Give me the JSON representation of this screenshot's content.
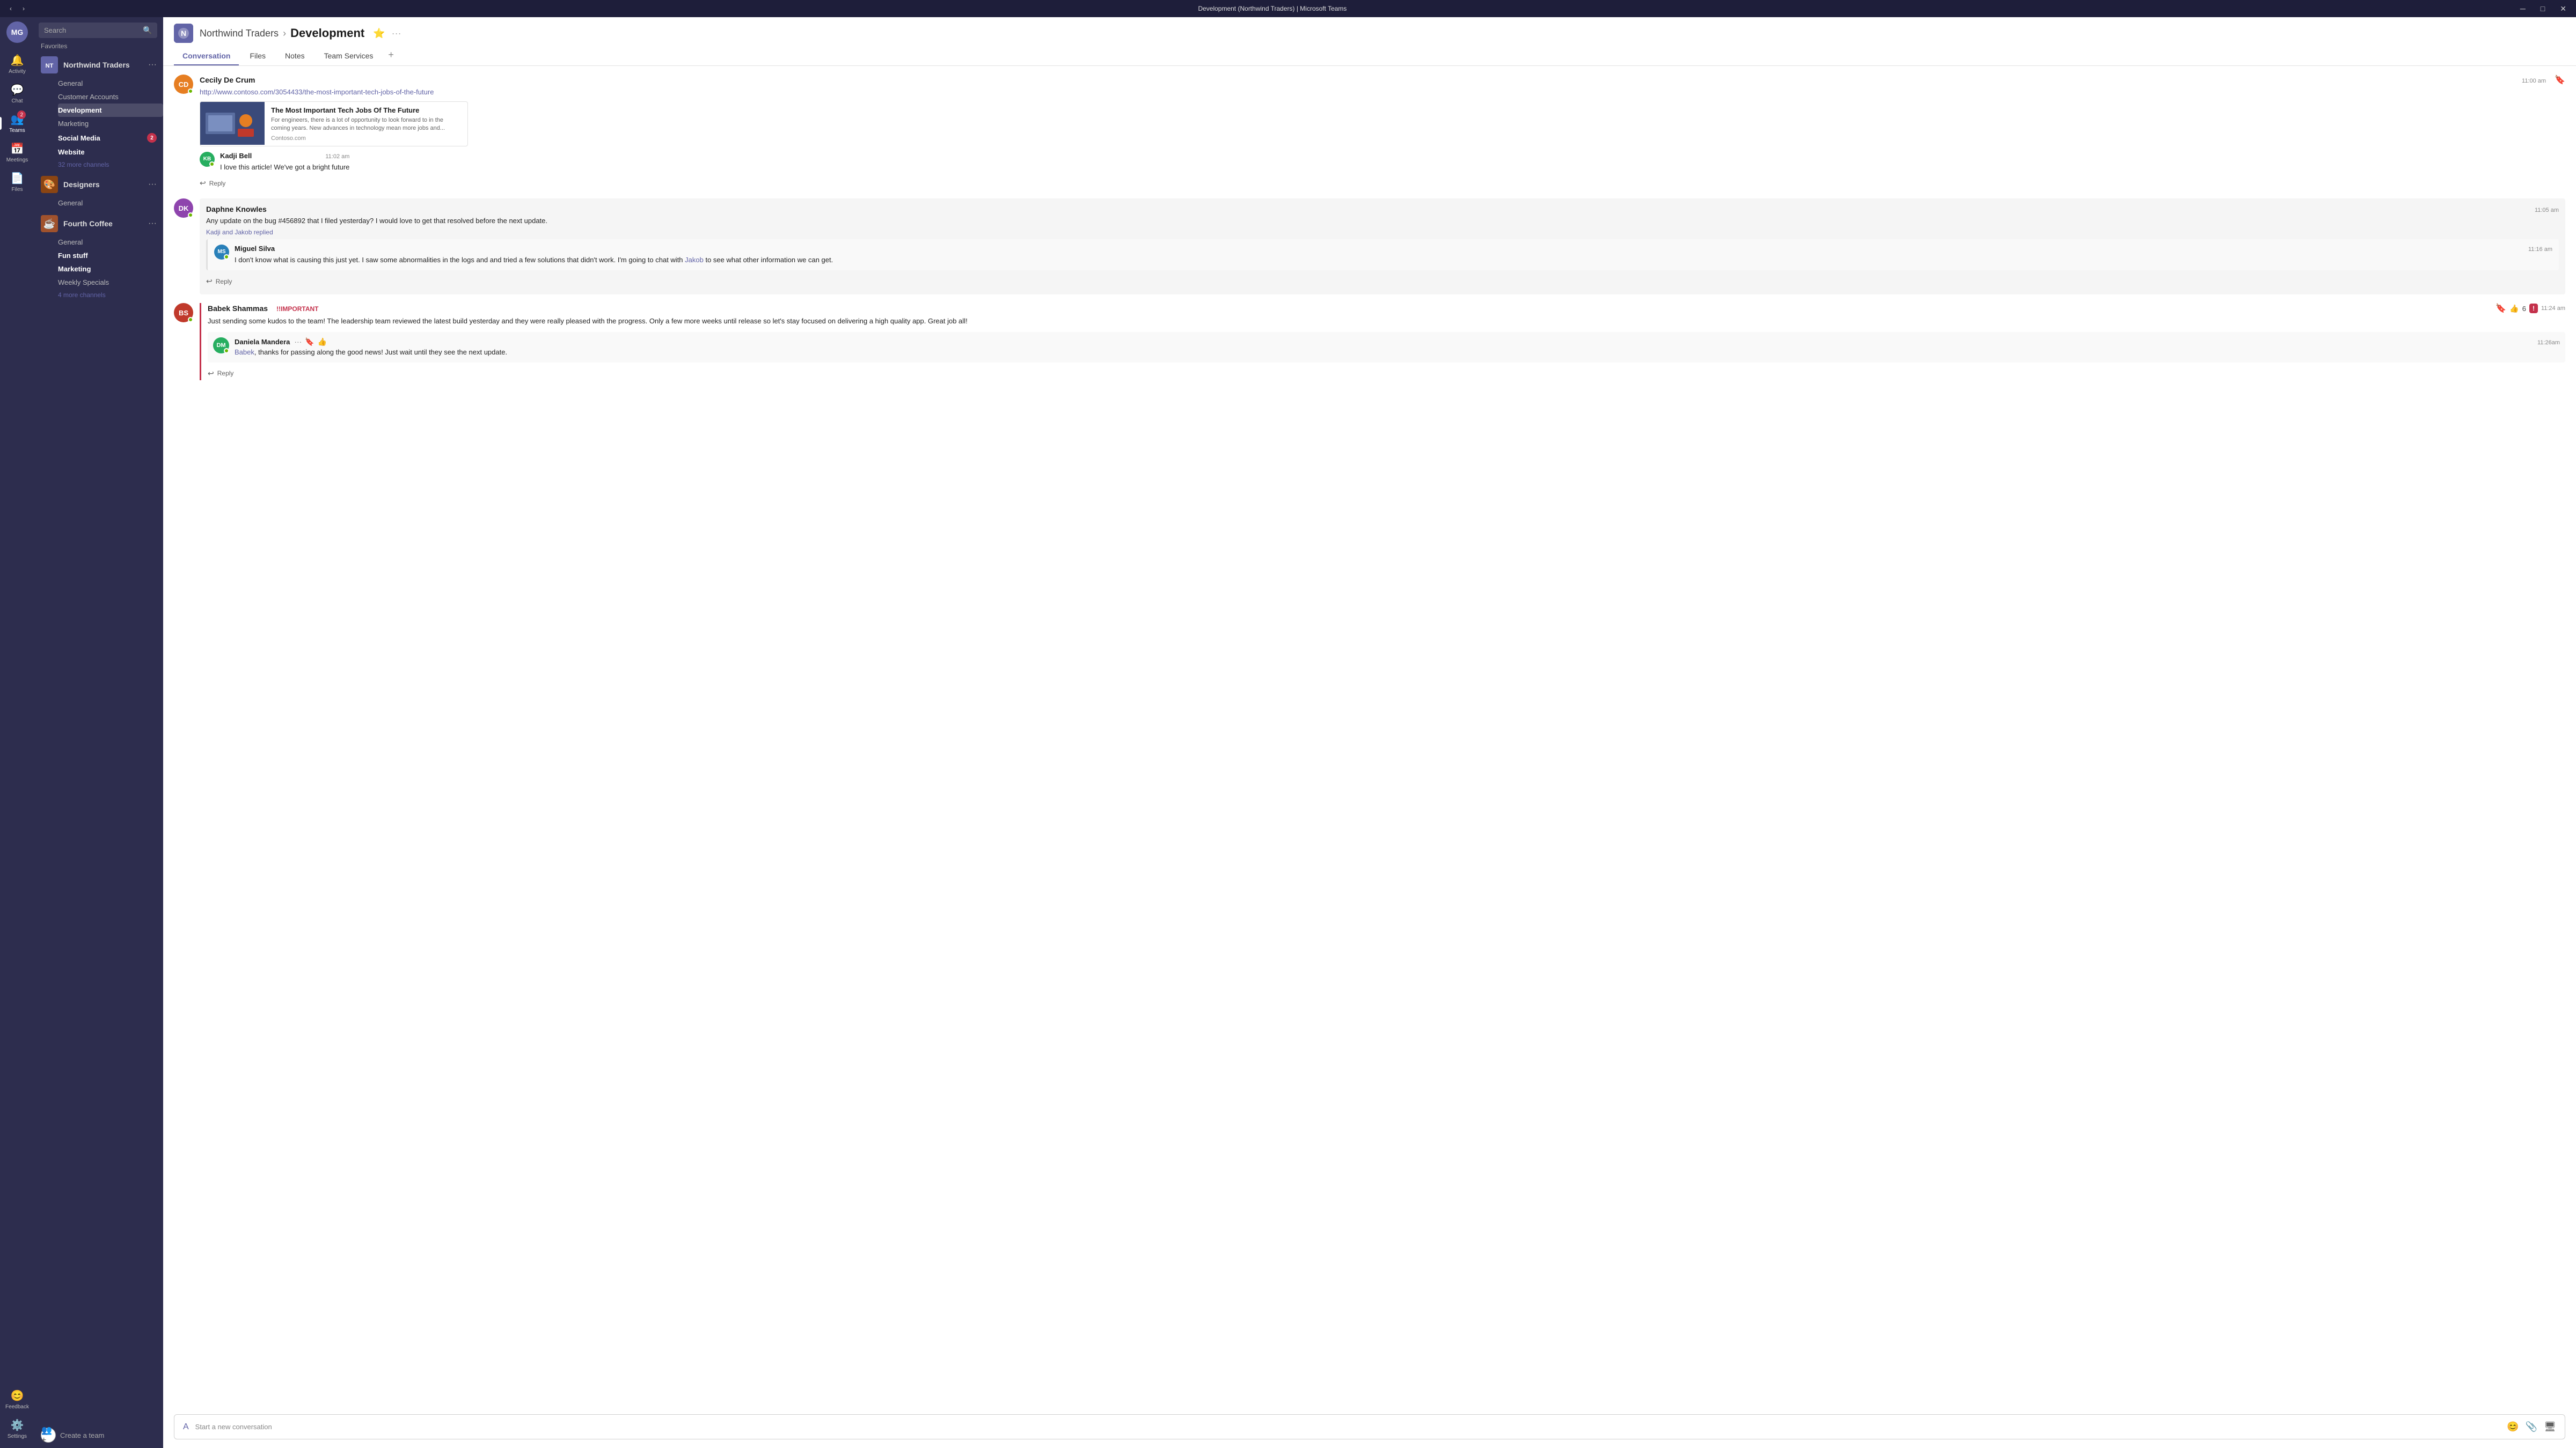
{
  "titleBar": {
    "title": "Development (Northwind Traders) | Microsoft Teams",
    "minBtn": "─",
    "maxBtn": "□",
    "closeBtn": "✕",
    "backBtn": "‹",
    "forwardBtn": "›"
  },
  "rail": {
    "userInitials": "MG",
    "items": [
      {
        "id": "activity",
        "label": "Activity",
        "icon": "🔔",
        "badge": null
      },
      {
        "id": "chat",
        "label": "Chat",
        "icon": "💬",
        "badge": null
      },
      {
        "id": "teams",
        "label": "Teams",
        "icon": "👥",
        "badge": "2",
        "active": true
      },
      {
        "id": "meetings",
        "label": "Meetings",
        "icon": "📅",
        "badge": null
      },
      {
        "id": "files",
        "label": "Files",
        "icon": "📄",
        "badge": null
      }
    ],
    "bottomItems": [
      {
        "id": "feedback",
        "label": "Feedback",
        "icon": "😊"
      },
      {
        "id": "settings",
        "label": "Settings",
        "icon": "⚙️"
      }
    ]
  },
  "sidebar": {
    "searchPlaceholder": "Search",
    "favoritesLabel": "Favorites",
    "teams": [
      {
        "id": "northwind",
        "name": "Northwind Traders",
        "avatarBg": "#6264a7",
        "avatarText": "NT",
        "avatarType": "logo",
        "channels": [
          {
            "id": "general",
            "label": "General",
            "active": false,
            "bold": false
          },
          {
            "id": "customer-accounts",
            "label": "Customer Accounts",
            "active": false,
            "bold": false
          },
          {
            "id": "development",
            "label": "Development",
            "active": true,
            "bold": false
          },
          {
            "id": "marketing",
            "label": "Marketing",
            "active": false,
            "bold": false
          },
          {
            "id": "social-media",
            "label": "Social Media",
            "active": false,
            "bold": true,
            "badge": "2"
          },
          {
            "id": "website",
            "label": "Website",
            "active": false,
            "bold": true
          }
        ],
        "moreChannels": "32 more channels"
      },
      {
        "id": "designers",
        "name": "Designers",
        "avatarBg": "#8b4513",
        "avatarText": "D",
        "avatarType": "emoji",
        "channels": [
          {
            "id": "general2",
            "label": "General",
            "active": false,
            "bold": false
          }
        ],
        "moreChannels": null
      },
      {
        "id": "fourth-coffee",
        "name": "Fourth Coffee",
        "avatarBg": "#8b4513",
        "avatarText": "FC",
        "avatarType": "logo2",
        "channels": [
          {
            "id": "general3",
            "label": "General",
            "active": false,
            "bold": false
          },
          {
            "id": "fun-stuff",
            "label": "Fun stuff",
            "active": false,
            "bold": true
          },
          {
            "id": "marketing2",
            "label": "Marketing",
            "active": false,
            "bold": true
          },
          {
            "id": "weekly-specials",
            "label": "Weekly Specials",
            "active": false,
            "bold": false
          }
        ],
        "moreChannels": "4 more channels"
      }
    ],
    "createTeam": "Create a team"
  },
  "header": {
    "teamLogo": "NT",
    "teamLogoColor": "#6264a7",
    "teamName": "Northwind Traders",
    "channelName": "Development",
    "tabs": [
      {
        "id": "conversation",
        "label": "Conversation",
        "active": true
      },
      {
        "id": "files",
        "label": "Files",
        "active": false
      },
      {
        "id": "notes",
        "label": "Notes",
        "active": false
      },
      {
        "id": "team-services",
        "label": "Team Services",
        "active": false
      }
    ]
  },
  "conversation": {
    "messages": [
      {
        "id": "msg1",
        "sender": "Cecily De Crum",
        "initials": "CD",
        "avatarBg": "#e67e22",
        "online": true,
        "time": "11:00 am",
        "link": "http://www.contoso.com/3054433/the-most-important-tech-jobs-of-the-future",
        "bookmarked": true,
        "preview": {
          "title": "The Most Important Tech Jobs Of The Future",
          "description": "For engineers, there is a lot of opportunity to look forward to in the coming years. New advances in technology mean more jobs and...",
          "source": "Contoso.com"
        },
        "replies": [
          {
            "id": "reply1",
            "sender": "Kadji Bell",
            "initials": "KB",
            "avatarBg": "#27ae60",
            "online": true,
            "time": "11:02 am",
            "text": "I love this article! We've got a bright future"
          }
        ],
        "replyBtn": "Reply"
      },
      {
        "id": "msg2",
        "sender": "Daphne Knowles",
        "initials": "DK",
        "avatarBg": "#8e44ad",
        "online": true,
        "time": "11:05 am",
        "text": "Any update on the bug #456892 that I filed yesterday? I would love to get that resolved before the next update.",
        "bookmarked": false,
        "repliedBy": "Kadji and Jakob replied",
        "nestedReply": {
          "sender": "Miguel Silva",
          "initials": "MS",
          "avatarBg": "#2980b9",
          "online": true,
          "time": "11:16 am",
          "text": "I don't know what is causing this just yet. I saw some abnormalities in the logs and and tried a few solutions that didn't work. I'm going to chat with Jakob to see what other information we can get.",
          "mention": "Jakob"
        },
        "replyBtn": "Reply"
      },
      {
        "id": "msg3",
        "sender": "Babek Shammas",
        "initials": "BS",
        "avatarBg": "#c0392b",
        "online": true,
        "time": "11:24 am",
        "importantLabel": "!!IMPORTANT",
        "bookmarked": true,
        "likeCount": "6",
        "hasImportant": true,
        "text": "Just sending some kudos to the team! The leadership team reviewed the latest build yesterday and they were really pleased with the progress. Only a few more weeks until release so let's stay focused on delivering a high quality app. Great job all!",
        "inlineReply": {
          "sender": "Daniela Mandera",
          "initials": "DM",
          "avatarBg": "#27ae60",
          "online": true,
          "time": "11:26am",
          "text": "thanks for passing along the good news! Just wait until they see the next update.",
          "mention": "Babek"
        },
        "replyBtn": "Reply"
      }
    ],
    "composePlaceholder": "Start a new conversation"
  }
}
